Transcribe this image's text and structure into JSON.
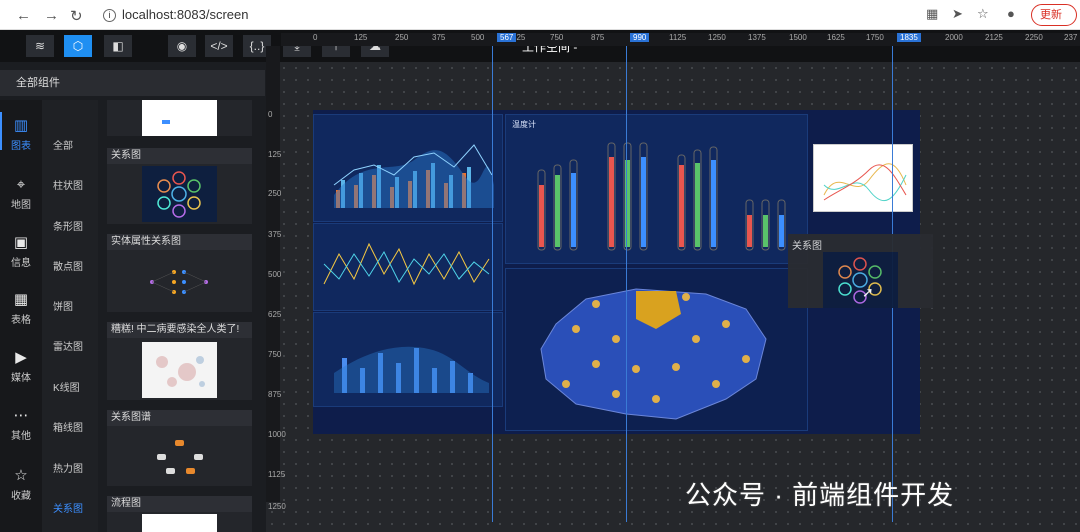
{
  "browser": {
    "url": "localhost:8083/screen",
    "update_label": "更新"
  },
  "toolbar": {
    "title": "工作空间 -"
  },
  "panel": {
    "header": "全部组件"
  },
  "icon_nav": [
    {
      "label": "图表",
      "icon": "bar-chart-icon",
      "active": true
    },
    {
      "label": "地图",
      "icon": "map-pin-icon"
    },
    {
      "label": "信息",
      "icon": "text-icon"
    },
    {
      "label": "表格",
      "icon": "table-icon"
    },
    {
      "label": "媒体",
      "icon": "media-icon"
    },
    {
      "label": "其他",
      "icon": "more-icon"
    },
    {
      "label": "收藏",
      "icon": "star-icon"
    }
  ],
  "categories": [
    "全部",
    "柱状图",
    "条形图",
    "散点图",
    "饼图",
    "雷达图",
    "K线图",
    "箱线图",
    "热力图",
    "关系图"
  ],
  "active_category": "关系图",
  "thumb_cards": [
    {
      "title": ""
    },
    {
      "title": "关系图"
    },
    {
      "title": "实体属性关系图"
    },
    {
      "title": "糟糕! 中二病要感染全人类了!"
    },
    {
      "title": "关系图谱"
    },
    {
      "title": "流程图"
    }
  ],
  "ruler_h": [
    "0",
    "125",
    "250",
    "375",
    "500",
    "625",
    "750",
    "875",
    "1125",
    "1250",
    "1375",
    "1500",
    "1625",
    "1750",
    "2000",
    "2125",
    "2250",
    "237"
  ],
  "ruler_marks": [
    "567",
    "990",
    "1835"
  ],
  "ruler_v": [
    "0",
    "125",
    "250",
    "375",
    "500",
    "625",
    "750",
    "875",
    "1000",
    "1125",
    "1250"
  ],
  "widgets": {
    "thermo_title": "温度计"
  },
  "popup_title": "关系图",
  "watermark": "公众号 · 前端组件开发"
}
